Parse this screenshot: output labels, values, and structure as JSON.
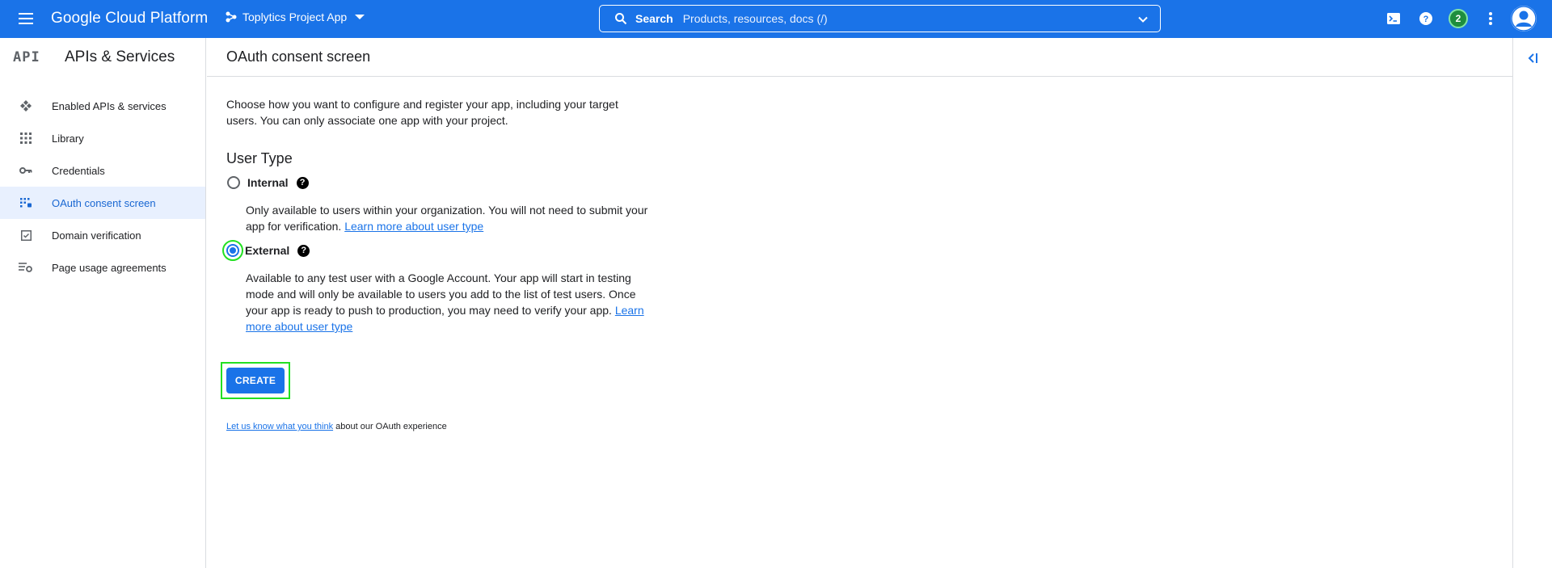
{
  "topbar": {
    "brand": "Google Cloud Platform",
    "project_name": "Toplytics Project App",
    "search_label": "Search",
    "search_placeholder": "Products, resources, docs (/)",
    "notification_count": "2",
    "accent_color": "#1a73e8"
  },
  "sidebar": {
    "badge": "API",
    "title": "APIs & Services",
    "items": [
      {
        "label": "Enabled APIs & services",
        "icon": "apis-icon",
        "active": false
      },
      {
        "label": "Library",
        "icon": "library-icon",
        "active": false
      },
      {
        "label": "Credentials",
        "icon": "key-icon",
        "active": false
      },
      {
        "label": "OAuth consent screen",
        "icon": "consent-icon",
        "active": true
      },
      {
        "label": "Domain verification",
        "icon": "checkbox-icon",
        "active": false
      },
      {
        "label": "Page usage agreements",
        "icon": "settings-list-icon",
        "active": false
      }
    ]
  },
  "main": {
    "title": "OAuth consent screen",
    "intro": "Choose how you want to configure and register your app, including your target users. You can only associate one app with your project.",
    "user_type": {
      "heading": "User Type",
      "options": [
        {
          "label": "Internal",
          "selected": false,
          "description": "Only available to users within your organization. You will not need to submit your app for verification.",
          "link": "Learn more about user type"
        },
        {
          "label": "External",
          "selected": true,
          "description": "Available to any test user with a Google Account. Your app will start in testing mode and will only be available to users you add to the list of test users. Once your app is ready to push to production, you may need to verify your app.",
          "link": "Learn more about user type"
        }
      ]
    },
    "create_label": "CREATE",
    "feedback_link": "Let us know what you think",
    "feedback_text": "about our OAuth experience"
  }
}
